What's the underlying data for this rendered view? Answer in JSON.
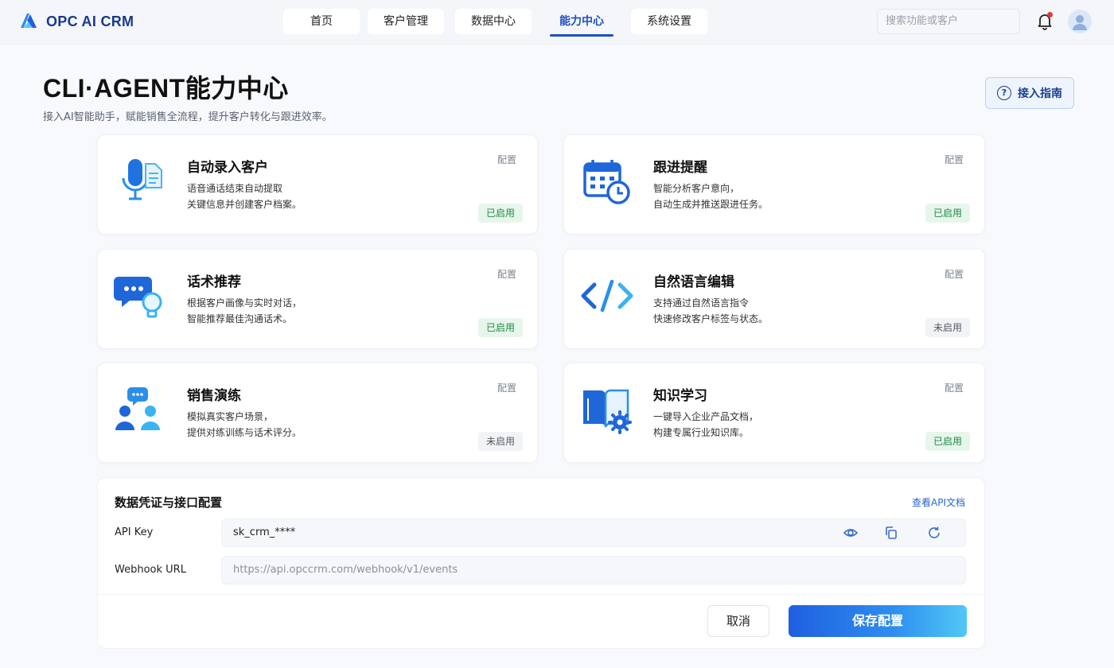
{
  "app": {
    "name": "OPC AI CRM"
  },
  "nav": {
    "tabs": [
      {
        "label": "首页"
      },
      {
        "label": "客户管理"
      },
      {
        "label": "数据中心"
      },
      {
        "label": "能力中心"
      },
      {
        "label": "系统设置"
      }
    ],
    "active_tab": "能力中心",
    "search_placeholder": "搜索功能或客户",
    "has_notification": true
  },
  "header": {
    "title": "CLI·AGENT能力中心",
    "subtitle": "接入AI智能助手，赋能销售全流程，提升客户转化与跟进效率。",
    "guide_button": "接入指南"
  },
  "capabilities": [
    {
      "title": "自动录入客户",
      "desc1": "语音通话结束自动提取",
      "desc2": "关键信息并创建客户档案。",
      "config": "配置",
      "status": "已启用",
      "enabled": true,
      "icon": "microphone-document-icon"
    },
    {
      "title": "跟进提醒",
      "desc1": "智能分析客户意向，",
      "desc2": "自动生成并推送跟进任务。",
      "config": "配置",
      "status": "已启用",
      "enabled": true,
      "icon": "calendar-clock-icon"
    },
    {
      "title": "话术推荐",
      "desc1": "根据客户画像与实时对话，",
      "desc2": "智能推荐最佳沟通话术。",
      "config": "配置",
      "status": "已启用",
      "enabled": true,
      "icon": "chat-bulb-icon"
    },
    {
      "title": "自然语言编辑",
      "desc1": "支持通过自然语言指令",
      "desc2": "快速修改客户标签与状态。",
      "config": "配置",
      "status": "未启用",
      "enabled": false,
      "icon": "code-icon"
    },
    {
      "title": "销售演练",
      "desc1": "模拟真实客户场景，",
      "desc2": "提供对练训练与话术评分。",
      "config": "配置",
      "status": "未启用",
      "enabled": false,
      "icon": "people-chat-icon"
    },
    {
      "title": "知识学习",
      "desc1": "一键导入企业产品文档，",
      "desc2": "构建专属行业知识库。",
      "config": "配置",
      "status": "已启用",
      "enabled": true,
      "icon": "book-gear-icon"
    }
  ],
  "credentials": {
    "title": "数据凭证与接口配置",
    "doc_link": "查看API文档",
    "api_key_label": "API Key",
    "api_key_value": "sk_crm_****",
    "webhook_label": "Webhook URL",
    "webhook_placeholder": "https://api.opccrm.com/webhook/v1/events",
    "cancel_button": "取消",
    "save_button": "保存配置"
  },
  "colors": {
    "brand": "#1d4fc4",
    "enabled_bg": "#e7f6ec",
    "enabled_text": "#1e8a43",
    "disabled_bg": "#f2f3f5"
  }
}
